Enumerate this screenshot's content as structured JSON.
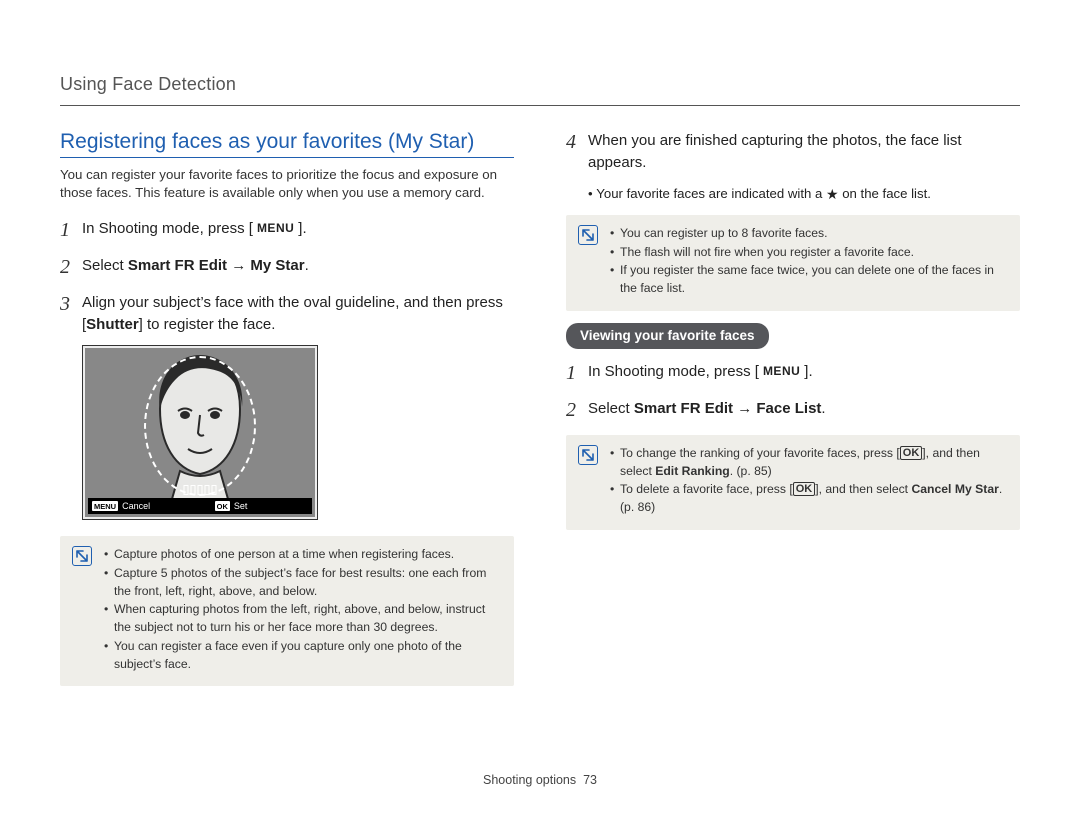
{
  "header": {
    "title": "Using Face Detection"
  },
  "section": {
    "title": "Registering faces as your favorites (My Star)",
    "intro": "You can register your favorite faces to prioritize the focus and exposure on those faces. This feature is available only when you use a memory card."
  },
  "labels": {
    "menu": "MENU",
    "ok": "OK",
    "arrow": "→",
    "star": "★"
  },
  "left_steps": {
    "s1_a": "In Shooting mode, press [",
    "s1_b": "].",
    "s2_a": "Select ",
    "s2_b": "Smart FR Edit",
    "s2_c": "My Star",
    "s2_d": ".",
    "s3_a": "Align your subject’s face with the oval guideline, and then press [",
    "s3_b": "Shutter",
    "s3_c": "] to register the face."
  },
  "illus_bar": {
    "cancel": "Cancel",
    "set": "Set"
  },
  "left_note": {
    "items": [
      "Capture photos of one person at a time when registering faces.",
      "Capture 5 photos of the subject’s face for best results: one each from the front, left, right, above, and below.",
      "When capturing photos from the left, right, above, and below, instruct the subject not to turn his or her face more than 30 degrees.",
      "You can register a face even if you capture only one photo of the subject’s face."
    ]
  },
  "right_steps": {
    "s4_a": "When you are finished capturing the photos, the face list appears.",
    "s4_sub_a": "Your favorite faces are indicated with a ",
    "s4_sub_b": " on the face list."
  },
  "right_note1": {
    "items": [
      "You can register up to 8 favorite faces.",
      "The flash will not fire when you register a favorite face.",
      "If you register the same face twice, you can delete one of the faces in the face list."
    ]
  },
  "pill": {
    "label": "Viewing your favorite faces"
  },
  "view_steps": {
    "s1_a": "In Shooting mode, press [",
    "s1_b": "].",
    "s2_a": "Select ",
    "s2_b": "Smart FR Edit",
    "s2_c": "Face List",
    "s2_d": "."
  },
  "right_note2": {
    "i1_a": "To change the ranking of your favorite faces, press [",
    "i1_b": "], and then select ",
    "i1_c": "Edit Ranking",
    "i1_d": ". (p. 85)",
    "i2_a": "To delete a favorite face, press [",
    "i2_b": "], and then select ",
    "i2_c": "Cancel My Star",
    "i2_d": ". (p. 86)"
  },
  "footer": {
    "section": "Shooting options",
    "page": "73"
  }
}
